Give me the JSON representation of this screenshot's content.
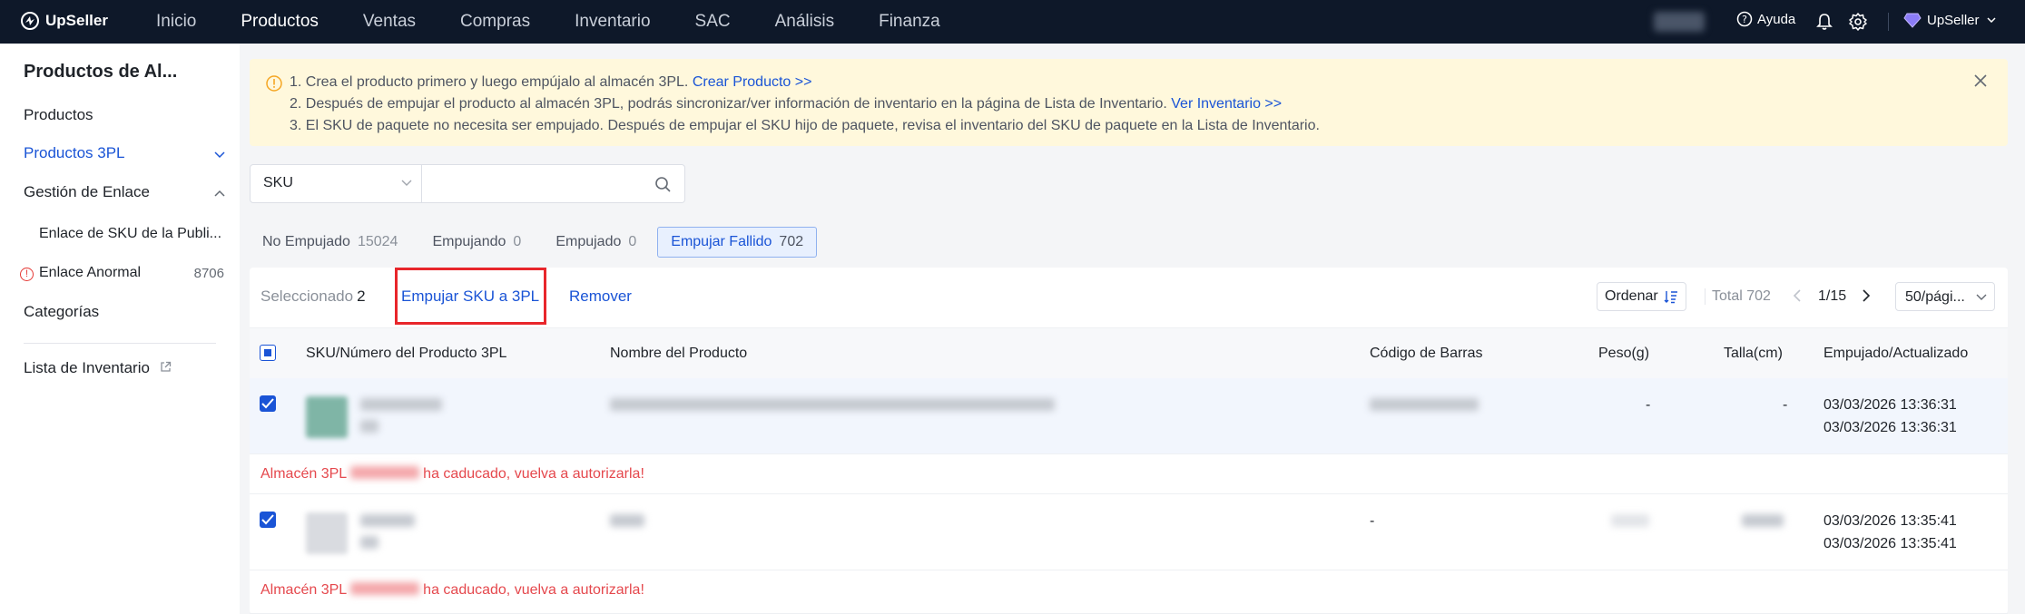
{
  "brand": {
    "name": "UpSeller"
  },
  "nav": {
    "items": [
      "Inicio",
      "Productos",
      "Ventas",
      "Compras",
      "Inventario",
      "SAC",
      "Análisis",
      "Finanza"
    ],
    "active": "Productos"
  },
  "topbar": {
    "help": "Ayuda",
    "user": "UpSeller"
  },
  "sidebar": {
    "title": "Productos de Al...",
    "items": {
      "productos": "Productos",
      "productos_3pl": "Productos 3PL",
      "gestion_enlace": "Gestión de Enlace",
      "enlace_sku": "Enlace de SKU de la Publi...",
      "enlace_anormal": "Enlace Anormal",
      "enlace_anormal_count": "8706",
      "categorias": "Categorías",
      "lista_inventario": "Lista de Inventario"
    }
  },
  "notice": {
    "line1_text": "1. Crea el producto primero y luego empújalo al almacén 3PL.",
    "line1_link": "Crear Producto >>",
    "line2_text": "2. Después de empujar el producto al almacén 3PL, podrás sincronizar/ver información de inventario en la página de Lista de Inventario.",
    "line2_link": "Ver Inventario >>",
    "line3_text": "3. El SKU de paquete no necesita ser empujado. Después de empujar el SKU hijo de paquete, revisa el inventario del SKU de paquete en la Lista de Inventario."
  },
  "search": {
    "field": "SKU",
    "placeholder": ""
  },
  "tabs": [
    {
      "label": "No Empujado",
      "count": "15024"
    },
    {
      "label": "Empujando",
      "count": "0"
    },
    {
      "label": "Empujado",
      "count": "0"
    },
    {
      "label": "Empujar Fallido",
      "count": "702"
    }
  ],
  "toolbar": {
    "selected_label": "Seleccionado",
    "selected_count": "2",
    "push_label": "Empujar SKU a 3PL",
    "remove_label": "Remover",
    "order_label": "Ordenar",
    "total_label": "Total 702",
    "page": "1/15",
    "page_size": "50/pági..."
  },
  "table": {
    "headers": {
      "sku": "SKU/Número del Producto 3PL",
      "name": "Nombre del Producto",
      "barcode": "Código de Barras",
      "weight": "Peso(g)",
      "size": "Talla(cm)",
      "pushed": "Empujado/Actualizado"
    },
    "rows": [
      {
        "weight": "-",
        "size": "-",
        "pushed": "03/03/2026 13:36:31",
        "updated": "03/03/2026 13:36:31",
        "error_prefix": "Almacén 3PL",
        "error_suffix": "ha caducado, vuelva a autorizarla!"
      },
      {
        "barcode": "-",
        "pushed": "03/03/2026 13:35:41",
        "updated": "03/03/2026 13:35:41",
        "error_prefix": "Almacén 3PL",
        "error_suffix": "ha caducado, vuelva a autorizarla!"
      }
    ]
  },
  "colors": {
    "accent": "#1a54d6",
    "topbar": "#0e1829",
    "error": "#e5484d",
    "highlight": "#e8262b",
    "notice_bg": "#fff8dc"
  }
}
